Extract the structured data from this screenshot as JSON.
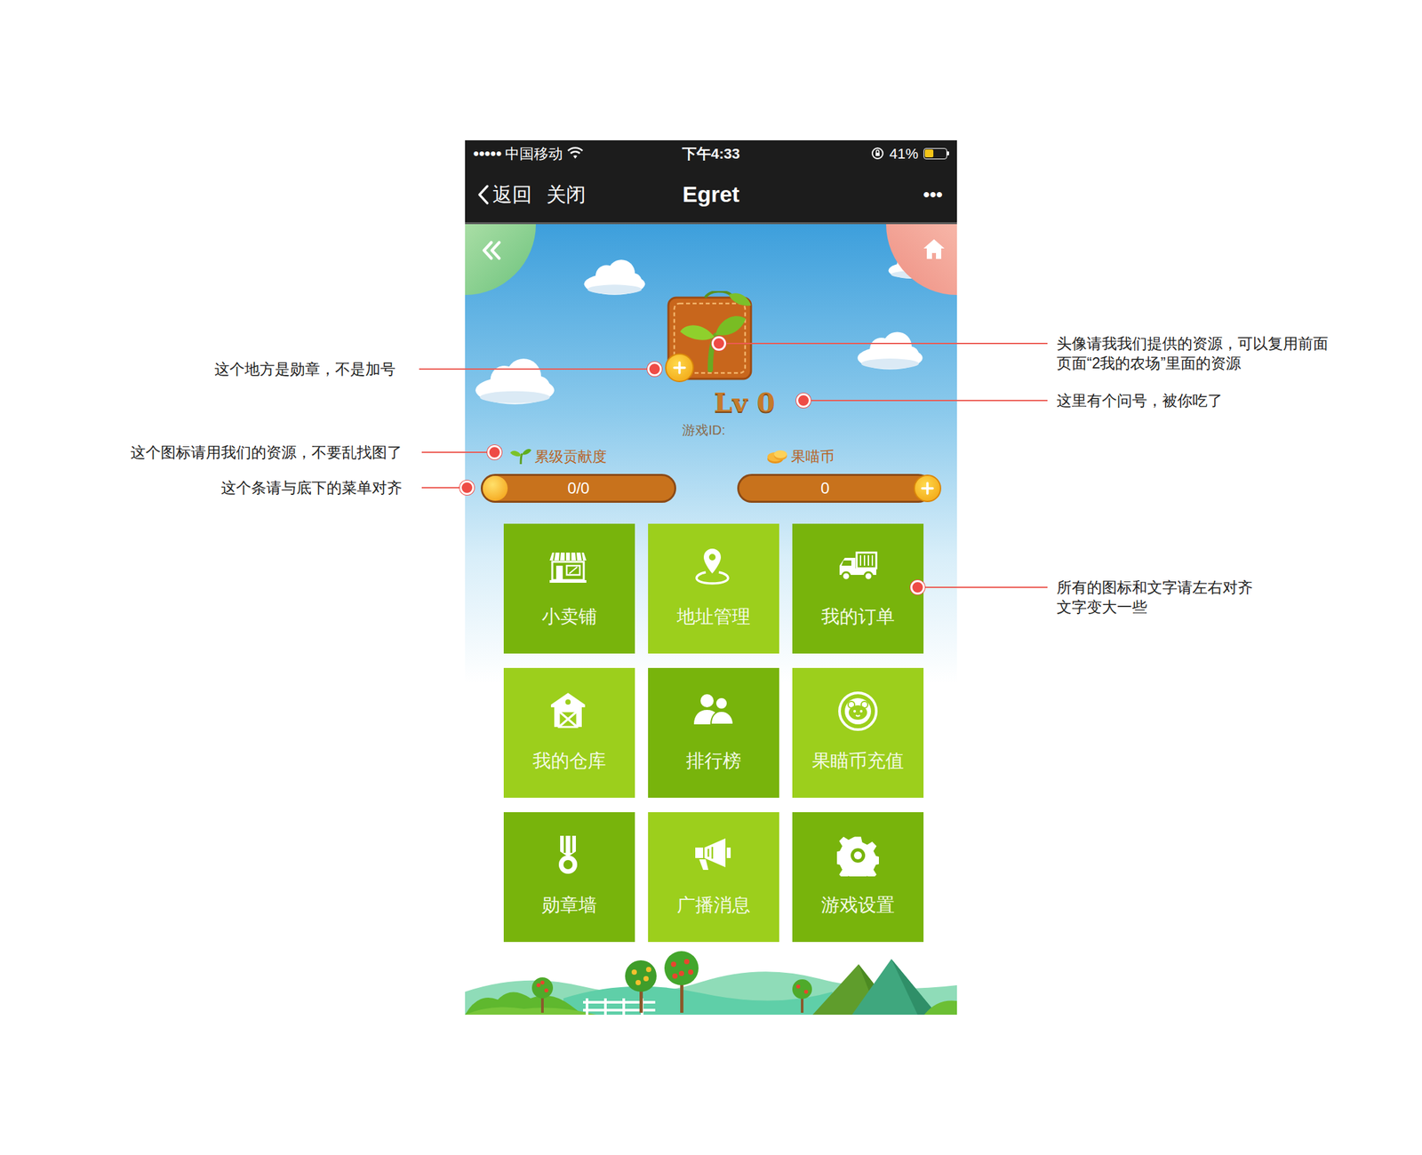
{
  "status_bar": {
    "signal": "●●●●●",
    "carrier": "中国移动",
    "time": "下午4:33",
    "battery": "41%",
    "battery_level": 0.41
  },
  "nav": {
    "back": "返回",
    "close": "关闭",
    "title": "Egret",
    "more": "•••"
  },
  "profile": {
    "level": "Lv 0",
    "game_id": "游戏ID:"
  },
  "stats": [
    {
      "label": "累级贡献度",
      "value": "0/0",
      "level": 0
    },
    {
      "label": "果喵币",
      "value": "0"
    }
  ],
  "menu": [
    {
      "label": "小卖铺"
    },
    {
      "label": "地址管理"
    },
    {
      "label": "我的订单"
    },
    {
      "label": "我的仓库"
    },
    {
      "label": "排行榜"
    },
    {
      "label": "果瞄币充值"
    },
    {
      "label": "勋章墙"
    },
    {
      "label": "广播消息"
    },
    {
      "label": "游戏设置"
    }
  ],
  "annotations": [
    {
      "lines": [
        "这个地方是勋章，不是加号"
      ]
    },
    {
      "lines": [
        "这个图标请用我们的资源，不要乱找图了"
      ]
    },
    {
      "lines": [
        "这个条请与底下的菜单对齐"
      ]
    },
    {
      "lines": [
        "头像请我我们提供的资源，可以复用前面",
        "页面“2我的农场”里面的资源"
      ]
    },
    {
      "lines": [
        "这里有个问号，被你吃了"
      ]
    },
    {
      "lines": [
        "所有的图标和文字请左右对齐",
        "文字变大一些"
      ]
    }
  ]
}
